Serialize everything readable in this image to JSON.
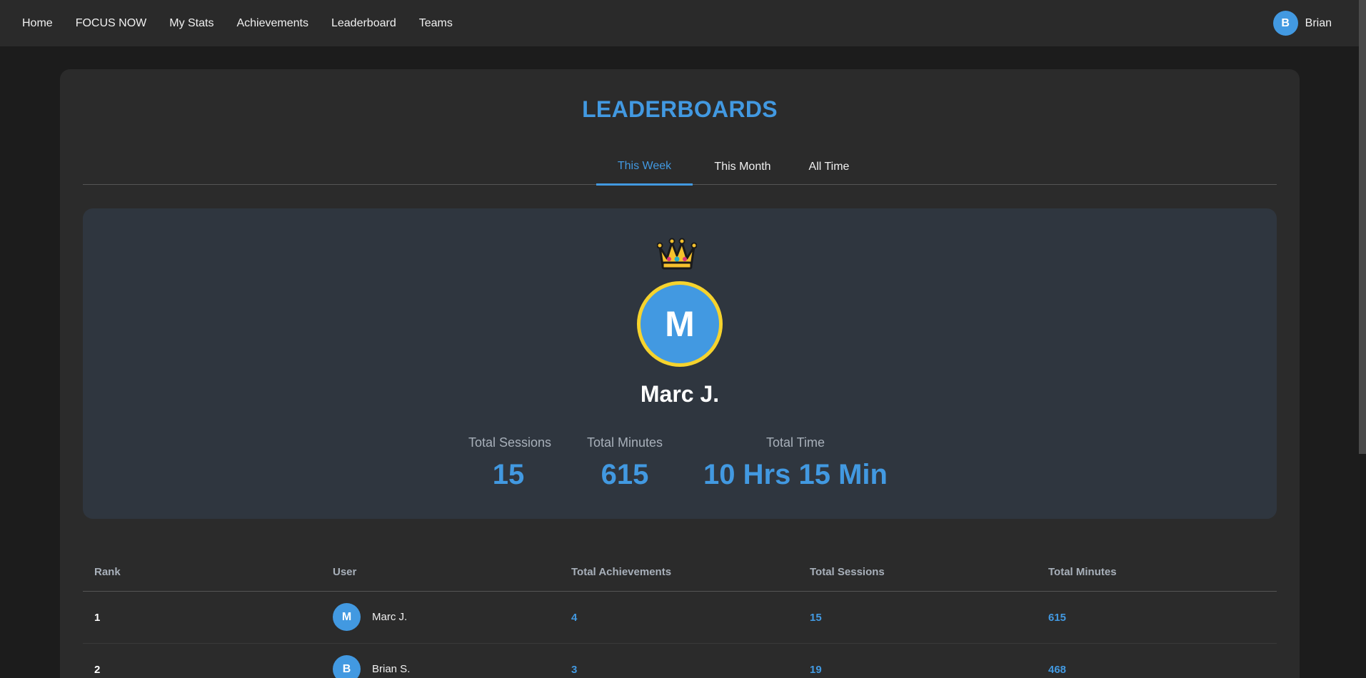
{
  "nav": {
    "items": [
      "Home",
      "FOCUS NOW",
      "My Stats",
      "Achievements",
      "Leaderboard",
      "Teams"
    ],
    "user": {
      "initial": "B",
      "name": "Brian"
    }
  },
  "page": {
    "title": "LEADERBOARDS",
    "tabs": [
      {
        "label": "This Week",
        "active": true
      },
      {
        "label": "This Month",
        "active": false
      },
      {
        "label": "All Time",
        "active": false
      }
    ]
  },
  "champion": {
    "icon": "crown-icon",
    "initial": "M",
    "name": "Marc J.",
    "stats": [
      {
        "label": "Total Sessions",
        "value": "15"
      },
      {
        "label": "Total Minutes",
        "value": "615"
      },
      {
        "label": "Total Time",
        "value": "10 Hrs 15 Min"
      }
    ]
  },
  "table": {
    "headers": [
      "Rank",
      "User",
      "Total Achievements",
      "Total Sessions",
      "Total Minutes"
    ],
    "rows": [
      {
        "rank": "1",
        "initial": "M",
        "name": "Marc J.",
        "achievements": "4",
        "sessions": "15",
        "minutes": "615"
      },
      {
        "rank": "2",
        "initial": "B",
        "name": "Brian S.",
        "achievements": "3",
        "sessions": "19",
        "minutes": "468"
      }
    ]
  },
  "colors": {
    "accent": "#4299e1",
    "champion_ring": "#f6d32d",
    "background": "#1c1c1c",
    "card": "#2b2b2b",
    "champion_panel": "#2f363f"
  }
}
